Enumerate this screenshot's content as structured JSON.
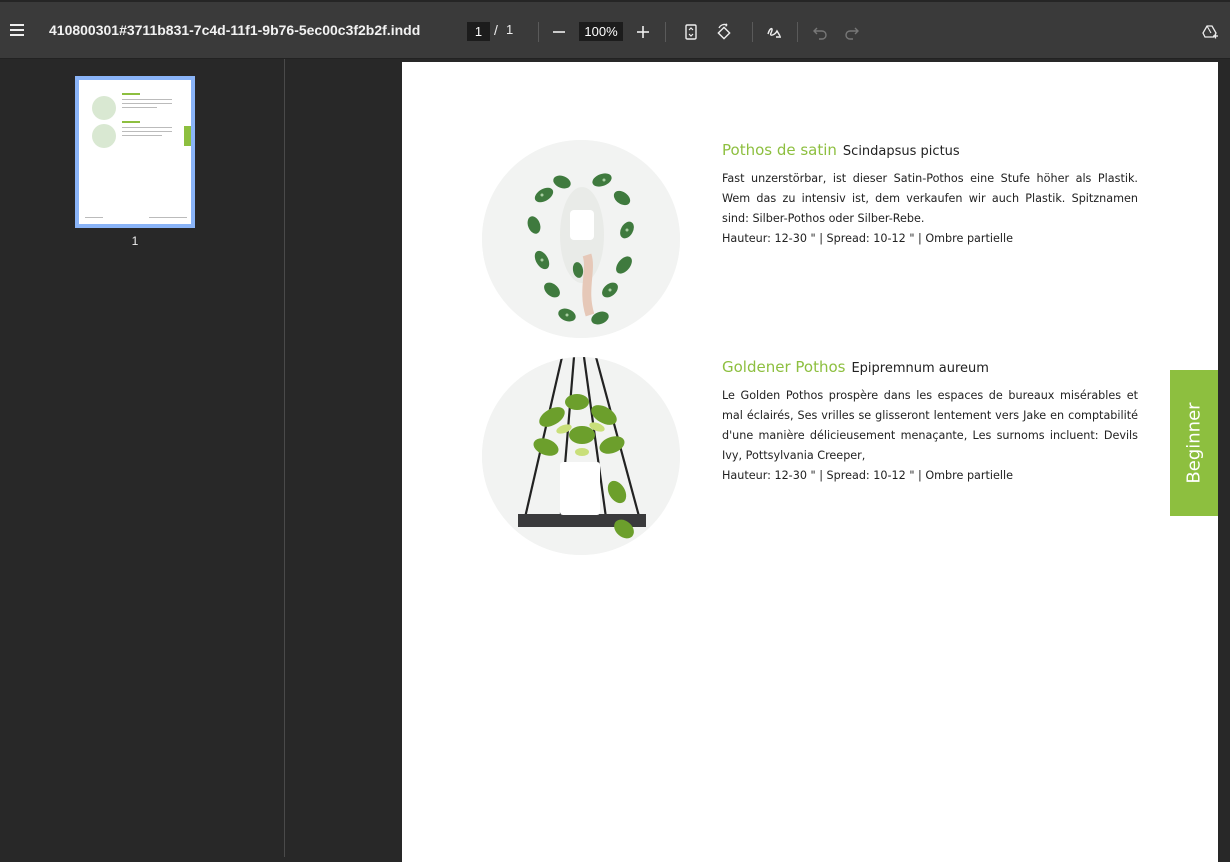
{
  "toolbar": {
    "title": "410800301#3711b831-7c4d-11f1-9b76-5ec00c3f2b2f.indd",
    "current_page": "1",
    "page_separator": "/",
    "total_pages": "1",
    "zoom": "100%"
  },
  "sidebar": {
    "thumbnail_label": "1"
  },
  "document": {
    "level_tab": "Beginner",
    "plants": [
      {
        "name": "Pothos de satin",
        "scientific": "Scindapsus pictus",
        "description": "Fast unzerstörbar, ist dieser Satin-Pothos eine Stufe höher als Plastik. Wem das zu intensiv ist, dem verkaufen wir auch Plastik. Spitznamen sind: Silber-Pothos oder Silber-Rebe.",
        "meta": "Hauteur: 12-30 \" | Spread: 10-12 \" | Ombre partielle"
      },
      {
        "name": "Goldener Pothos",
        "scientific": "Epipremnum aureum",
        "description": "Le Golden Pothos prospère dans les espaces de bureaux misérables et mal éclairés, Ses vrilles se glisseront lentement vers Jake en comptabilité d'une manière délicieusement menaçante, Les surnoms incluent: Devils Ivy, Pottsylvania Creeper,",
        "meta": "Hauteur: 12-30 \" | Spread: 10-12 \" | Ombre partielle"
      }
    ]
  },
  "colors": {
    "accent": "#8dbf3f",
    "toolbar_bg": "#3a3a3a",
    "viewer_bg": "#282828",
    "thumbnail_border": "#8ab4f8"
  }
}
